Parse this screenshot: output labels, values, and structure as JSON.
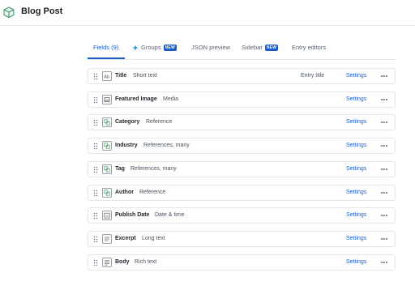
{
  "header": {
    "title": "Blog Post",
    "icon": "content-type-box-icon"
  },
  "tabs": [
    {
      "label": "Fields (9)",
      "active": true
    },
    {
      "label": "Groups",
      "badge": "NEW",
      "icon": "groups-icon"
    },
    {
      "label": "JSON preview"
    },
    {
      "label": "Sidebar",
      "badge": "NEW"
    },
    {
      "label": "Entry editors"
    }
  ],
  "fields": [
    {
      "name": "Title",
      "kind": "Short text",
      "icon": "short-text-icon",
      "entry_title": "Entry title",
      "settings": "Settings"
    },
    {
      "name": "Featured Image",
      "kind": "Media",
      "icon": "media-icon",
      "settings": "Settings"
    },
    {
      "name": "Category",
      "kind": "Reference",
      "icon": "reference-icon",
      "settings": "Settings"
    },
    {
      "name": "Industry",
      "kind": "References, many",
      "icon": "reference-icon",
      "settings": "Settings"
    },
    {
      "name": "Tag",
      "kind": "References, many",
      "icon": "reference-icon",
      "settings": "Settings"
    },
    {
      "name": "Author",
      "kind": "Reference",
      "icon": "reference-icon",
      "settings": "Settings"
    },
    {
      "name": "Publish Date",
      "kind": "Date & time",
      "icon": "date-icon",
      "settings": "Settings"
    },
    {
      "name": "Excerpt",
      "kind": "Long text",
      "icon": "long-text-icon",
      "settings": "Settings"
    },
    {
      "name": "Body",
      "kind": "Rich text",
      "icon": "rich-text-icon",
      "settings": "Settings"
    }
  ],
  "colors": {
    "accent": "#1a5cc9",
    "border": "#e3e5e8",
    "text": "#1f2328",
    "muted": "#4b5360"
  }
}
